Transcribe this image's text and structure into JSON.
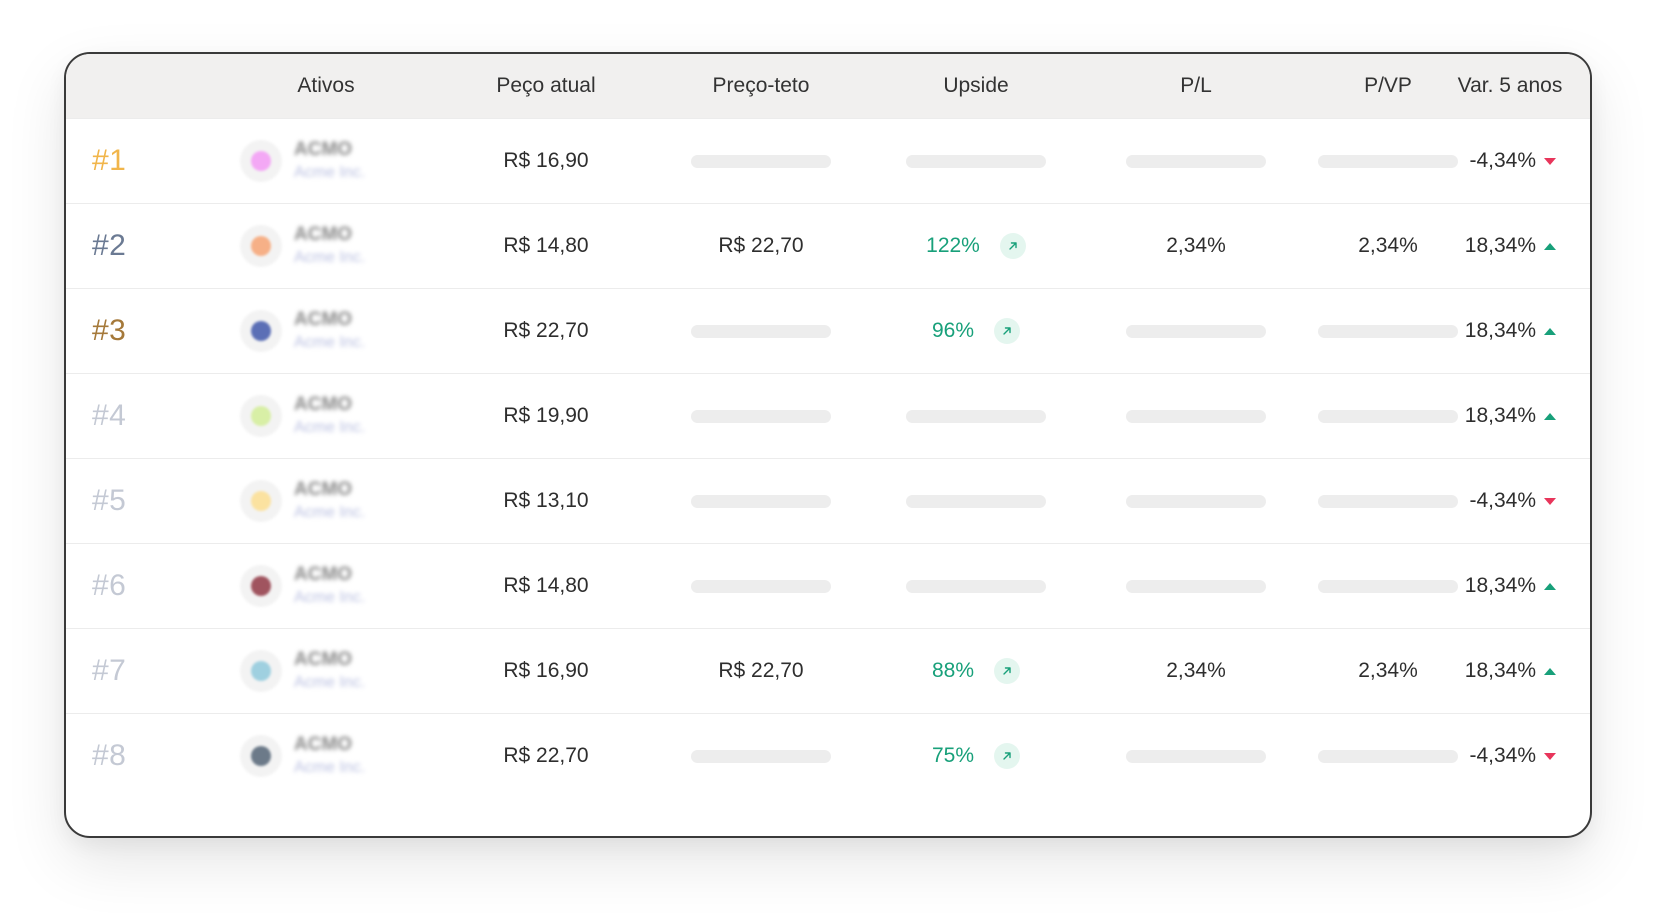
{
  "header": {
    "ativos": "Ativos",
    "preco_atual": "Peço atual",
    "preco_teto": "Preço-teto",
    "upside": "Upside",
    "pl": "P/L",
    "pvp": "P/VP",
    "var5": "Var. 5 anos"
  },
  "colors": {
    "positive": "#18a07a",
    "negative": "#e8355b",
    "placeholder": "#ededed"
  },
  "rows": [
    {
      "rank": "#1",
      "rank_color": "#f1b54a",
      "ticker": "ACMO",
      "company": "Acme Inc.",
      "logo_color": "#f3a8f5",
      "price": "R$ 16,90",
      "ceiling": null,
      "upside": null,
      "pl": null,
      "pvp": null,
      "var": "-4,34%",
      "trend": "down"
    },
    {
      "rank": "#2",
      "rank_color": "#6b7a93",
      "ticker": "ACMO",
      "company": "Acme Inc.",
      "logo_color": "#f6b087",
      "price": "R$ 14,80",
      "ceiling": "R$ 22,70",
      "upside": "122%",
      "pl": "2,34%",
      "pvp": "2,34%",
      "var": "18,34%",
      "trend": "up"
    },
    {
      "rank": "#3",
      "rank_color": "#a5793a",
      "ticker": "ACMO",
      "company": "Acme Inc.",
      "logo_color": "#5b6fb6",
      "price": "R$ 22,70",
      "ceiling": null,
      "upside": "96%",
      "pl": null,
      "pvp": null,
      "var": "18,34%",
      "trend": "up"
    },
    {
      "rank": "#4",
      "rank_color": "#c4c9d4",
      "ticker": "ACMO",
      "company": "Acme Inc.",
      "logo_color": "#d8efa6",
      "price": "R$ 19,90",
      "ceiling": null,
      "upside": null,
      "pl": null,
      "pvp": null,
      "var": "18,34%",
      "trend": "up"
    },
    {
      "rank": "#5",
      "rank_color": "#c4c9d4",
      "ticker": "ACMO",
      "company": "Acme Inc.",
      "logo_color": "#fbe2a0",
      "price": "R$ 13,10",
      "ceiling": null,
      "upside": null,
      "pl": null,
      "pvp": null,
      "var": "-4,34%",
      "trend": "down"
    },
    {
      "rank": "#6",
      "rank_color": "#c4c9d4",
      "ticker": "ACMO",
      "company": "Acme Inc.",
      "logo_color": "#a0545f",
      "price": "R$ 14,80",
      "ceiling": null,
      "upside": null,
      "pl": null,
      "pvp": null,
      "var": "18,34%",
      "trend": "up"
    },
    {
      "rank": "#7",
      "rank_color": "#c4c9d4",
      "ticker": "ACMO",
      "company": "Acme Inc.",
      "logo_color": "#9fd0e0",
      "price": "R$ 16,90",
      "ceiling": "R$ 22,70",
      "upside": "88%",
      "pl": "2,34%",
      "pvp": "2,34%",
      "var": "18,34%",
      "trend": "up"
    },
    {
      "rank": "#8",
      "rank_color": "#c4c9d4",
      "ticker": "ACMO",
      "company": "Acme Inc.",
      "logo_color": "#6c7a89",
      "price": "R$ 22,70",
      "ceiling": null,
      "upside": "75%",
      "pl": null,
      "pvp": null,
      "var": "-4,34%",
      "trend": "down"
    }
  ]
}
